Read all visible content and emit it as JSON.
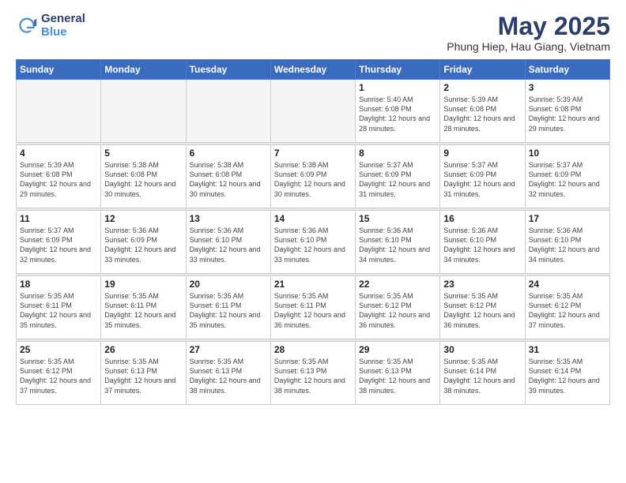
{
  "header": {
    "logo_general": "General",
    "logo_blue": "Blue",
    "month_title": "May 2025",
    "location": "Phung Hiep, Hau Giang, Vietnam"
  },
  "weekdays": [
    "Sunday",
    "Monday",
    "Tuesday",
    "Wednesday",
    "Thursday",
    "Friday",
    "Saturday"
  ],
  "weeks": [
    [
      {
        "day": "",
        "info": ""
      },
      {
        "day": "",
        "info": ""
      },
      {
        "day": "",
        "info": ""
      },
      {
        "day": "",
        "info": ""
      },
      {
        "day": "1",
        "info": "Sunrise: 5:40 AM\nSunset: 6:08 PM\nDaylight: 12 hours\nand 28 minutes."
      },
      {
        "day": "2",
        "info": "Sunrise: 5:39 AM\nSunset: 6:08 PM\nDaylight: 12 hours\nand 28 minutes."
      },
      {
        "day": "3",
        "info": "Sunrise: 5:39 AM\nSunset: 6:08 PM\nDaylight: 12 hours\nand 29 minutes."
      }
    ],
    [
      {
        "day": "4",
        "info": "Sunrise: 5:39 AM\nSunset: 6:08 PM\nDaylight: 12 hours\nand 29 minutes."
      },
      {
        "day": "5",
        "info": "Sunrise: 5:38 AM\nSunset: 6:08 PM\nDaylight: 12 hours\nand 30 minutes."
      },
      {
        "day": "6",
        "info": "Sunrise: 5:38 AM\nSunset: 6:08 PM\nDaylight: 12 hours\nand 30 minutes."
      },
      {
        "day": "7",
        "info": "Sunrise: 5:38 AM\nSunset: 6:09 PM\nDaylight: 12 hours\nand 30 minutes."
      },
      {
        "day": "8",
        "info": "Sunrise: 5:37 AM\nSunset: 6:09 PM\nDaylight: 12 hours\nand 31 minutes."
      },
      {
        "day": "9",
        "info": "Sunrise: 5:37 AM\nSunset: 6:09 PM\nDaylight: 12 hours\nand 31 minutes."
      },
      {
        "day": "10",
        "info": "Sunrise: 5:37 AM\nSunset: 6:09 PM\nDaylight: 12 hours\nand 32 minutes."
      }
    ],
    [
      {
        "day": "11",
        "info": "Sunrise: 5:37 AM\nSunset: 6:09 PM\nDaylight: 12 hours\nand 32 minutes."
      },
      {
        "day": "12",
        "info": "Sunrise: 5:36 AM\nSunset: 6:09 PM\nDaylight: 12 hours\nand 33 minutes."
      },
      {
        "day": "13",
        "info": "Sunrise: 5:36 AM\nSunset: 6:10 PM\nDaylight: 12 hours\nand 33 minutes."
      },
      {
        "day": "14",
        "info": "Sunrise: 5:36 AM\nSunset: 6:10 PM\nDaylight: 12 hours\nand 33 minutes."
      },
      {
        "day": "15",
        "info": "Sunrise: 5:36 AM\nSunset: 6:10 PM\nDaylight: 12 hours\nand 34 minutes."
      },
      {
        "day": "16",
        "info": "Sunrise: 5:36 AM\nSunset: 6:10 PM\nDaylight: 12 hours\nand 34 minutes."
      },
      {
        "day": "17",
        "info": "Sunrise: 5:36 AM\nSunset: 6:10 PM\nDaylight: 12 hours\nand 34 minutes."
      }
    ],
    [
      {
        "day": "18",
        "info": "Sunrise: 5:35 AM\nSunset: 6:11 PM\nDaylight: 12 hours\nand 35 minutes."
      },
      {
        "day": "19",
        "info": "Sunrise: 5:35 AM\nSunset: 6:11 PM\nDaylight: 12 hours\nand 35 minutes."
      },
      {
        "day": "20",
        "info": "Sunrise: 5:35 AM\nSunset: 6:11 PM\nDaylight: 12 hours\nand 35 minutes."
      },
      {
        "day": "21",
        "info": "Sunrise: 5:35 AM\nSunset: 6:11 PM\nDaylight: 12 hours\nand 36 minutes."
      },
      {
        "day": "22",
        "info": "Sunrise: 5:35 AM\nSunset: 6:12 PM\nDaylight: 12 hours\nand 36 minutes."
      },
      {
        "day": "23",
        "info": "Sunrise: 5:35 AM\nSunset: 6:12 PM\nDaylight: 12 hours\nand 36 minutes."
      },
      {
        "day": "24",
        "info": "Sunrise: 5:35 AM\nSunset: 6:12 PM\nDaylight: 12 hours\nand 37 minutes."
      }
    ],
    [
      {
        "day": "25",
        "info": "Sunrise: 5:35 AM\nSunset: 6:12 PM\nDaylight: 12 hours\nand 37 minutes."
      },
      {
        "day": "26",
        "info": "Sunrise: 5:35 AM\nSunset: 6:13 PM\nDaylight: 12 hours\nand 37 minutes."
      },
      {
        "day": "27",
        "info": "Sunrise: 5:35 AM\nSunset: 6:13 PM\nDaylight: 12 hours\nand 38 minutes."
      },
      {
        "day": "28",
        "info": "Sunrise: 5:35 AM\nSunset: 6:13 PM\nDaylight: 12 hours\nand 38 minutes."
      },
      {
        "day": "29",
        "info": "Sunrise: 5:35 AM\nSunset: 6:13 PM\nDaylight: 12 hours\nand 38 minutes."
      },
      {
        "day": "30",
        "info": "Sunrise: 5:35 AM\nSunset: 6:14 PM\nDaylight: 12 hours\nand 38 minutes."
      },
      {
        "day": "31",
        "info": "Sunrise: 5:35 AM\nSunset: 6:14 PM\nDaylight: 12 hours\nand 39 minutes."
      }
    ]
  ]
}
